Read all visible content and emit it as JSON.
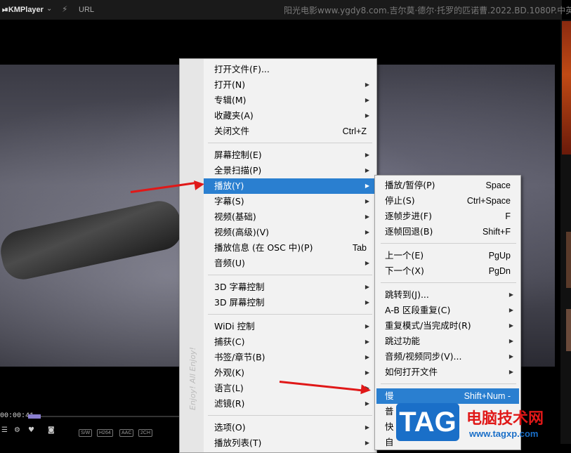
{
  "topbar": {
    "app_name": "KMPlayer",
    "url_label": "URL",
    "title": "阳光电影www.ygdy8.com.吉尔莫·德尔·托罗的匹诺曹.2022.BD.1080P.中英双字."
  },
  "player": {
    "time": "00:00:41",
    "badges": [
      "S/W",
      "H264",
      "AAC",
      "2CH"
    ]
  },
  "main_menu": {
    "side_text": "Enjoy! All Enjoy!",
    "groups": [
      [
        {
          "label": "打开文件(F)...",
          "shortcut": "",
          "submenu": false
        },
        {
          "label": "打开(N)",
          "shortcut": "",
          "submenu": true
        },
        {
          "label": "专辑(M)",
          "shortcut": "",
          "submenu": true
        },
        {
          "label": "收藏夹(A)",
          "shortcut": "",
          "submenu": true
        },
        {
          "label": "关闭文件",
          "shortcut": "Ctrl+Z",
          "submenu": false
        }
      ],
      [
        {
          "label": "屏幕控制(E)",
          "shortcut": "",
          "submenu": true
        },
        {
          "label": "全景扫描(P)",
          "shortcut": "",
          "submenu": true
        },
        {
          "label": "播放(Y)",
          "shortcut": "",
          "submenu": true,
          "highlight": true
        },
        {
          "label": "字幕(S)",
          "shortcut": "",
          "submenu": true
        },
        {
          "label": "视频(基础)",
          "shortcut": "",
          "submenu": true
        },
        {
          "label": "视频(高级)(V)",
          "shortcut": "",
          "submenu": true
        },
        {
          "label": "播放信息 (在 OSC 中)(P)",
          "shortcut": "Tab",
          "submenu": false
        },
        {
          "label": "音频(U)",
          "shortcut": "",
          "submenu": true
        }
      ],
      [
        {
          "label": "3D 字幕控制",
          "shortcut": "",
          "submenu": true
        },
        {
          "label": "3D 屏幕控制",
          "shortcut": "",
          "submenu": true
        }
      ],
      [
        {
          "label": "WiDi 控制",
          "shortcut": "",
          "submenu": true
        },
        {
          "label": "捕获(C)",
          "shortcut": "",
          "submenu": true
        },
        {
          "label": "书签/章节(B)",
          "shortcut": "",
          "submenu": true
        },
        {
          "label": "外观(K)",
          "shortcut": "",
          "submenu": true
        },
        {
          "label": "语言(L)",
          "shortcut": "",
          "submenu": true
        },
        {
          "label": "滤镜(R)",
          "shortcut": "",
          "submenu": true
        }
      ],
      [
        {
          "label": "选项(O)",
          "shortcut": "",
          "submenu": true
        },
        {
          "label": "播放列表(T)",
          "shortcut": "",
          "submenu": true
        }
      ]
    ]
  },
  "sub_menu": {
    "groups": [
      [
        {
          "label": "播放/暂停(P)",
          "shortcut": "Space",
          "submenu": false
        },
        {
          "label": "停止(S)",
          "shortcut": "Ctrl+Space",
          "submenu": false
        },
        {
          "label": "逐帧步进(F)",
          "shortcut": "F",
          "submenu": false
        },
        {
          "label": "逐帧回退(B)",
          "shortcut": "Shift+F",
          "submenu": false
        }
      ],
      [
        {
          "label": "上一个(E)",
          "shortcut": "PgUp",
          "submenu": false
        },
        {
          "label": "下一个(X)",
          "shortcut": "PgDn",
          "submenu": false
        }
      ],
      [
        {
          "label": "跳转到(J)...",
          "shortcut": "",
          "submenu": true
        },
        {
          "label": "A-B 区段重复(C)",
          "shortcut": "",
          "submenu": true
        },
        {
          "label": "重复模式/当完成时(R)",
          "shortcut": "",
          "submenu": true
        },
        {
          "label": "跳过功能",
          "shortcut": "",
          "submenu": true
        },
        {
          "label": "音频/视频同步(V)...",
          "shortcut": "",
          "submenu": true
        },
        {
          "label": "如何打开文件",
          "shortcut": "",
          "submenu": true
        }
      ],
      [
        {
          "label": "慢",
          "shortcut": "Shift+Num -",
          "submenu": false,
          "highlight": true
        },
        {
          "label": "普",
          "shortcut": "",
          "submenu": false
        },
        {
          "label": "快",
          "shortcut": "",
          "submenu": false
        },
        {
          "label": "自",
          "shortcut": "",
          "submenu": false
        }
      ]
    ]
  },
  "watermark": {
    "tag": "TAG",
    "site_name": "电脑技术网",
    "site_url": "www.tagxp.com"
  },
  "colors": {
    "highlight": "#2a7fd0",
    "arrow": "#e01818",
    "watermark_blue": "#1a6fc8"
  }
}
